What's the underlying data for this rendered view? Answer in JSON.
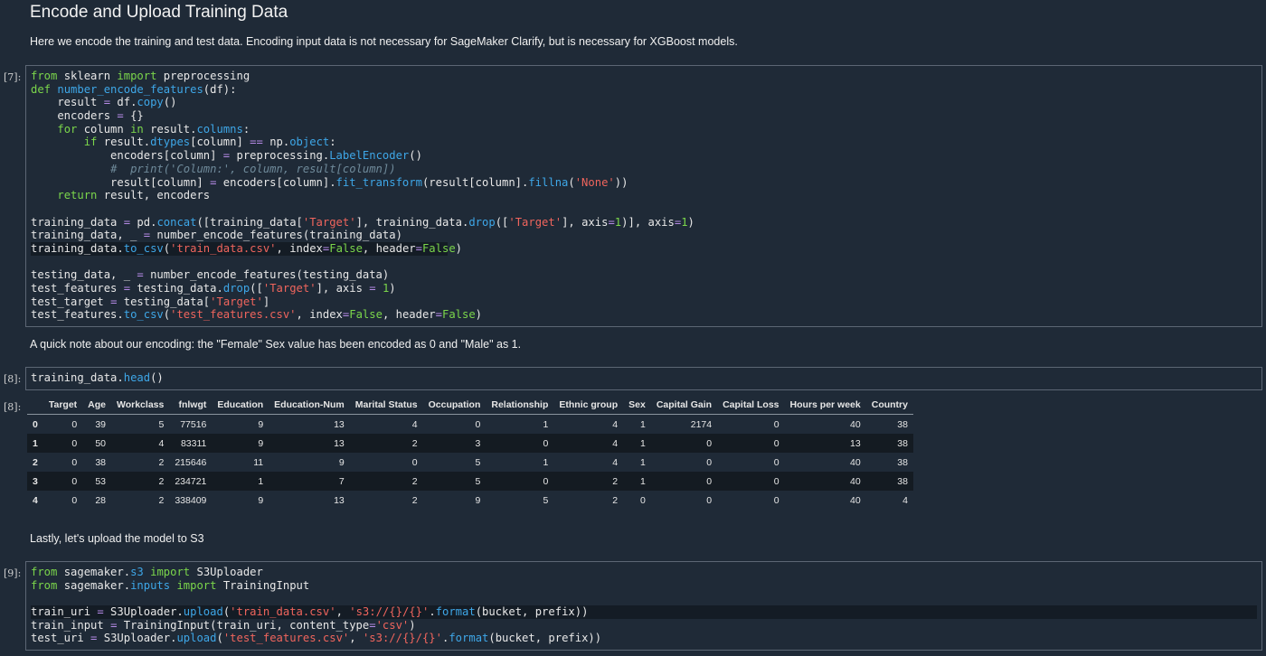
{
  "heading": "Encode and Upload Training Data",
  "intro": "Here we encode the training and test data. Encoding input data is not necessary for SageMaker Clarify, but is necessary for XGBoost models.",
  "note": "A quick note about our encoding: the \"Female\" Sex value has been encoded as 0 and \"Male\" as 1.",
  "lastly": "Lastly, let's upload the model to S3",
  "prompts": {
    "c7": "[7]:",
    "c8in": "[8]:",
    "c8out": "[8]:",
    "c9": "[9]:"
  },
  "cell8_code": "training_data.head()",
  "table": {
    "columns": [
      "",
      "Target",
      "Age",
      "Workclass",
      "fnlwgt",
      "Education",
      "Education-Num",
      "Marital Status",
      "Occupation",
      "Relationship",
      "Ethnic group",
      "Sex",
      "Capital Gain",
      "Capital Loss",
      "Hours per week",
      "Country"
    ],
    "rows": [
      [
        "0",
        "0",
        "39",
        "5",
        "77516",
        "9",
        "13",
        "4",
        "0",
        "1",
        "4",
        "1",
        "2174",
        "0",
        "40",
        "38"
      ],
      [
        "1",
        "0",
        "50",
        "4",
        "83311",
        "9",
        "13",
        "2",
        "3",
        "0",
        "4",
        "1",
        "0",
        "0",
        "13",
        "38"
      ],
      [
        "2",
        "0",
        "38",
        "2",
        "215646",
        "11",
        "9",
        "0",
        "5",
        "1",
        "4",
        "1",
        "0",
        "0",
        "40",
        "38"
      ],
      [
        "3",
        "0",
        "53",
        "2",
        "234721",
        "1",
        "7",
        "2",
        "5",
        "0",
        "2",
        "1",
        "0",
        "0",
        "40",
        "38"
      ],
      [
        "4",
        "0",
        "28",
        "2",
        "338409",
        "9",
        "13",
        "2",
        "9",
        "5",
        "2",
        "0",
        "0",
        "0",
        "40",
        "4"
      ]
    ]
  },
  "colors": {
    "background": "#1f2a37",
    "keyword": "#7bd64b",
    "function": "#3ea7e8",
    "string": "#f0655d",
    "comment": "#6f8a9a"
  }
}
